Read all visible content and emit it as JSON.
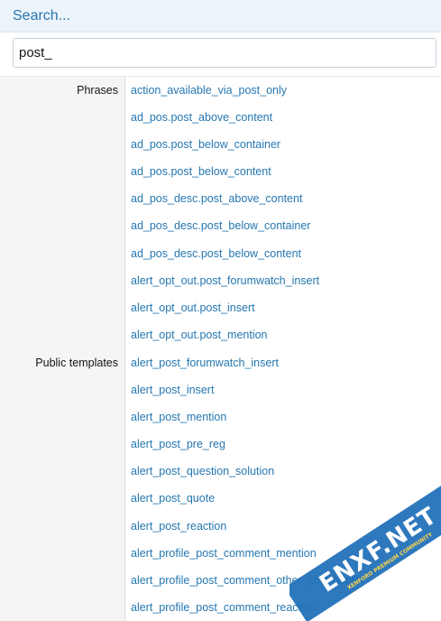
{
  "search": {
    "title": "Search...",
    "query": "post_"
  },
  "groups": [
    {
      "label": "Phrases",
      "items": [
        "action_available_via_post_only",
        "ad_pos.post_above_content",
        "ad_pos.post_below_container",
        "ad_pos.post_below_content",
        "ad_pos_desc.post_above_content",
        "ad_pos_desc.post_below_container",
        "ad_pos_desc.post_below_content",
        "alert_opt_out.post_forumwatch_insert",
        "alert_opt_out.post_insert",
        "alert_opt_out.post_mention"
      ]
    },
    {
      "label": "Public templates",
      "items": [
        "alert_post_forumwatch_insert",
        "alert_post_insert",
        "alert_post_mention",
        "alert_post_pre_reg",
        "alert_post_question_solution",
        "alert_post_quote",
        "alert_post_reaction",
        "alert_profile_post_comment_mention",
        "alert_profile_post_comment_other_commenter",
        "alert_profile_post_comment_reaction"
      ]
    }
  ],
  "watermark": {
    "logo_text": "ENXF.NET",
    "tagline": "XENFORO PREMIUM COMMUNITY",
    "ribbon_color": "#1e6fb8"
  }
}
